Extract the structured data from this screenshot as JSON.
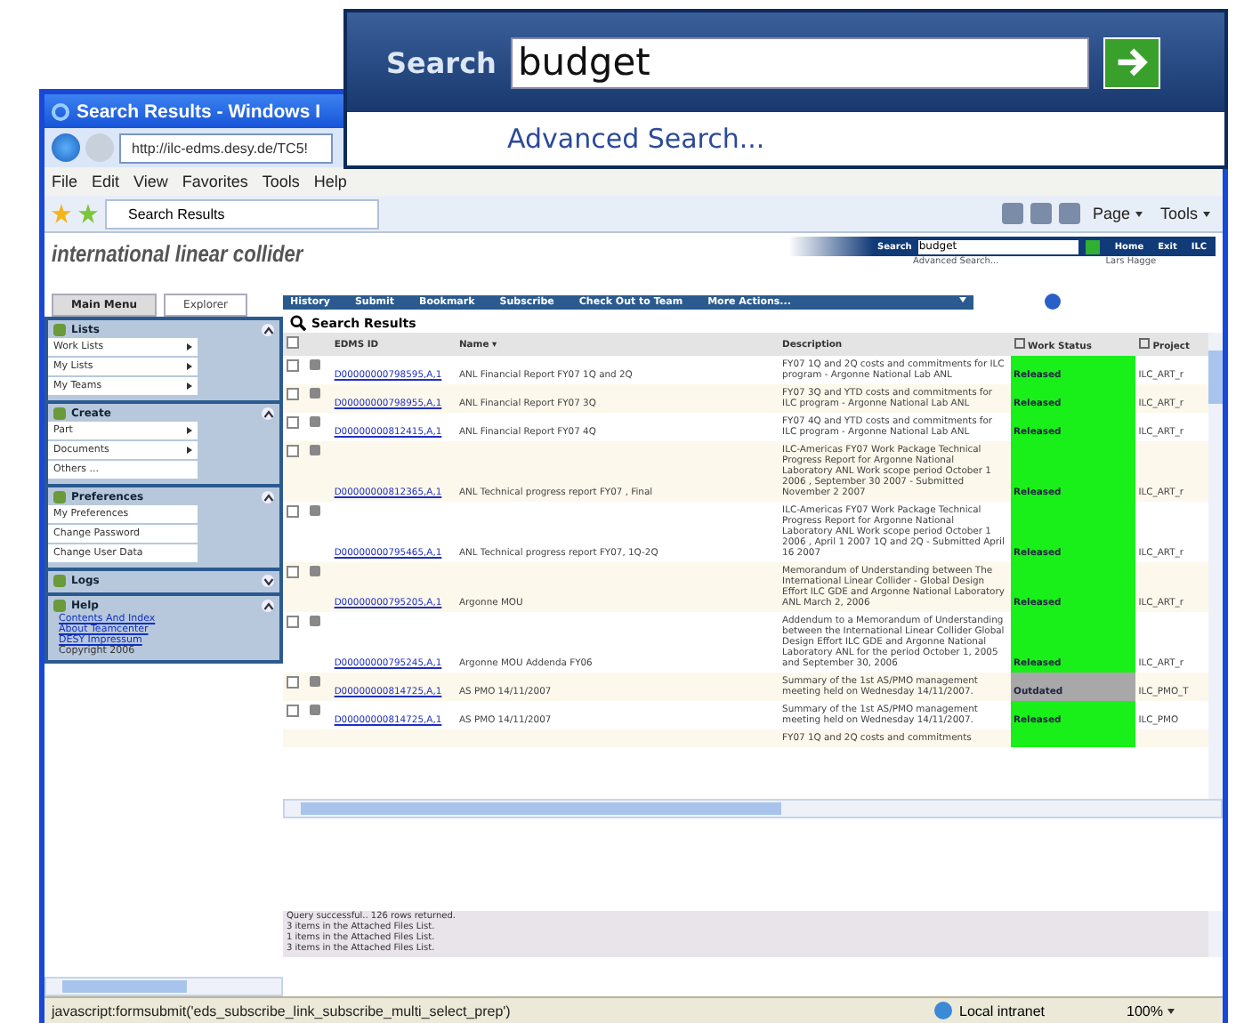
{
  "callout": {
    "search_label": "Search",
    "search_value": "budget",
    "advanced_link": "Advanced Search..."
  },
  "window": {
    "title": "Search Results - Windows I"
  },
  "address_bar": {
    "url": "http://ilc-edms.desy.de/TC5!"
  },
  "menu_bar": [
    "File",
    "Edit",
    "View",
    "Favorites",
    "Tools",
    "Help"
  ],
  "favorites_bar": {
    "tab": "Search Results",
    "buttons": [
      "Page",
      "Tools"
    ]
  },
  "header": {
    "logo": "international linear collider",
    "search_label": "Search",
    "search_value": "budget",
    "advanced_link": "Advanced Search...",
    "nav": [
      "Home",
      "Exit",
      "ILC"
    ],
    "user": "Lars Hagge"
  },
  "sidebar_tabs": [
    {
      "label": "Main Menu",
      "selected": true
    },
    {
      "label": "Explorer",
      "selected": false
    }
  ],
  "sidebar_sections": [
    {
      "title": "Lists",
      "expanded": true,
      "items": [
        {
          "label": "Work Lists",
          "submenu": true
        },
        {
          "label": "My Lists",
          "submenu": true
        },
        {
          "label": "My Teams",
          "submenu": true
        }
      ]
    },
    {
      "title": "Create",
      "expanded": true,
      "items": [
        {
          "label": "Part",
          "submenu": true
        },
        {
          "label": "Documents",
          "submenu": true
        },
        {
          "label": "Others ...",
          "submenu": false
        }
      ]
    },
    {
      "title": "Preferences",
      "expanded": true,
      "items": [
        {
          "label": "My Preferences",
          "submenu": false
        },
        {
          "label": "Change Password",
          "submenu": false
        },
        {
          "label": "Change User Data",
          "submenu": false
        }
      ]
    },
    {
      "title": "Logs",
      "expanded": false
    },
    {
      "title": "Help",
      "expanded": true,
      "links": [
        "Contents And Index",
        "About Teamcenter",
        "DESY Impressum"
      ],
      "note": "Copyright 2006"
    }
  ],
  "action_bar": [
    "History",
    "Submit",
    "Bookmark",
    "Subscribe",
    "Check Out to Team"
  ],
  "more_actions": "More Actions...",
  "results_title": "Search Results",
  "table": {
    "select_all_checked": false,
    "columns": [
      "EDMS ID",
      "Name ▾",
      "Description",
      "Work Status",
      "Project"
    ],
    "rows": [
      {
        "checked": false,
        "id": "D00000000798595,A,1",
        "name": "ANL Financial Report FY07 1Q and 2Q",
        "description": "FY07 1Q and 2Q costs and commitments for ILC program - Argonne National Lab ANL",
        "status": "Released",
        "color": "#19f019",
        "project": "ILC_ART_r"
      },
      {
        "checked": false,
        "id": "D00000000798955,A,1",
        "name": "ANL Financial Report FY07 3Q",
        "description": "FY07 3Q and YTD costs and commitments for ILC program - Argonne National Lab ANL",
        "status": "Released",
        "color": "#19f019",
        "project": "ILC_ART_r"
      },
      {
        "checked": false,
        "id": "D00000000812415,A,1",
        "name": "ANL Financial Report FY07 4Q",
        "description": "FY07 4Q and YTD costs and commitments for ILC program - Argonne National Lab ANL",
        "status": "Released",
        "color": "#19f019",
        "project": "ILC_ART_r"
      },
      {
        "checked": false,
        "id": "D00000000812365,A,1",
        "name": "ANL Technical progress report FY07 , Final",
        "description": "ILC-Americas FY07 Work Package Technical Progress Report for Argonne National Laboratory ANL Work scope period October 1 2006 , September 30 2007 - Submitted November 2 2007",
        "status": "Released",
        "color": "#19f019",
        "project": "ILC_ART_r"
      },
      {
        "checked": false,
        "id": "D00000000795465,A,1",
        "name": "ANL Technical progress report FY07, 1Q-2Q",
        "description": "ILC-Americas FY07 Work Package Technical Progress Report for Argonne National Laboratory ANL Work scope period October 1 2006 , April 1 2007 1Q and 2Q - Submitted April 16 2007",
        "status": "Released",
        "color": "#19f019",
        "project": "ILC_ART_r"
      },
      {
        "checked": false,
        "id": "D00000000795205,A,1",
        "name": "Argonne MOU",
        "description": "Memorandum of Understanding between The International Linear Collider - Global Design Effort ILC GDE and Argonne National Laboratory ANL March 2, 2006",
        "status": "Released",
        "color": "#19f019",
        "project": "ILC_ART_r"
      },
      {
        "checked": false,
        "id": "D00000000795245,A,1",
        "name": "Argonne MOU Addenda FY06",
        "description": "Addendum to a Memorandum of Understanding between the International Linear Collider Global Design Effort ILC GDE and Argonne National Laboratory ANL for the period October 1, 2005 and September 30, 2006",
        "status": "Released",
        "color": "#19f019",
        "project": "ILC_ART_r"
      },
      {
        "checked": false,
        "id": "D00000000814725,A,1",
        "name": "AS PMO 14/11/2007",
        "description": "Summary of the 1st AS/PMO management meeting held on Wednesday 14/11/2007.",
        "status": "Outdated",
        "color": "#a8a8a8",
        "project": "ILC_PMO_T"
      },
      {
        "checked": false,
        "id": "D00000000814725,A,1",
        "name": "AS PMO 14/11/2007",
        "description": "Summary of the 1st AS/PMO management meeting held on Wednesday 14/11/2007.",
        "status": "Released",
        "color": "#19f019",
        "project": "ILC_PMO"
      },
      {
        "description": "FY07 1Q and 2Q costs and commitments",
        "color": "#19f019"
      }
    ]
  },
  "messages": [
    "Query successful.. 126 rows returned.",
    "3 items in the Attached Files List.",
    "1 items in the Attached Files List.",
    "3 items in the Attached Files List."
  ],
  "status_bar": {
    "text": "javascript:formsubmit('eds_subscribe_link_subscribe_multi_select_prep')",
    "zone": "Local intranet",
    "zoom": "100%"
  }
}
